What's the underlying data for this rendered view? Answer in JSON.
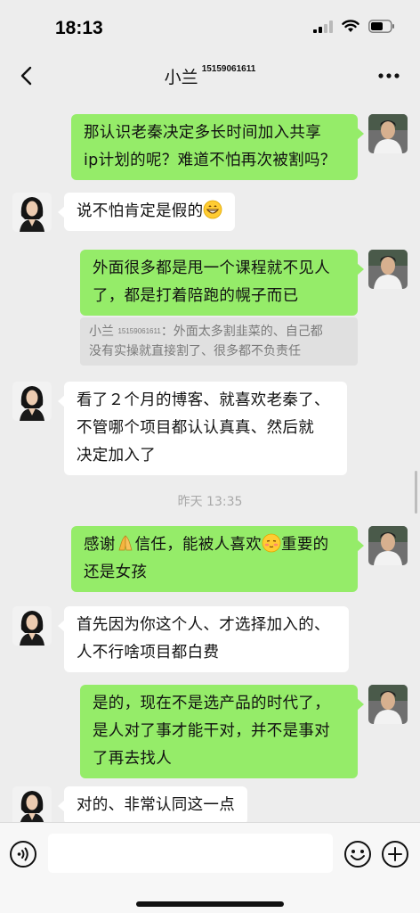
{
  "status_bar": {
    "time": "18:13"
  },
  "nav": {
    "title": "小兰",
    "phone": "15159061611"
  },
  "messages": [
    {
      "lines": [
        "那认识老秦决定多长时间加入共享",
        "ip计划的呢？难道不怕再次被割吗？"
      ]
    },
    {
      "text": "说不怕肯定是假的",
      "emoji": "grinning-emoji"
    },
    {
      "lines": [
        "外面很多都是甩一个课程就不见人",
        "了，都是打着陪跑的幌子而已"
      ]
    },
    {
      "quote_name": "小兰",
      "quote_phone": "15159061611",
      "quote_line1": "：外面太多割韭菜的、自己都",
      "quote_line2": "没有实操就直接割了、很多都不负责任"
    },
    {
      "lines": [
        "看了２个月的博客、就喜欢老秦了、",
        "不管哪个项目都认认真真、然后就",
        "决定加入了"
      ]
    },
    {
      "timestamp": "昨天 13:35"
    },
    {
      "line1_a": "感谢",
      "line1_b": "信任，能被人喜欢",
      "line1_c": "重要的",
      "line2": "还是女孩",
      "emoji1": "folded-hands-emoji",
      "emoji2": "blushing-emoji"
    },
    {
      "lines": [
        "首先因为你这个人、才选择加入的、",
        "人不行啥项目都白费"
      ]
    },
    {
      "lines": [
        "是的，现在不是选产品的时代了，",
        "是人对了事才能干对，并不是事对",
        "了再去找人"
      ]
    },
    {
      "text": "对的、非常认同这一点"
    }
  ],
  "colors": {
    "my_bubble": "#95ec69",
    "other_bubble": "#ffffff",
    "background": "#ededed"
  },
  "icons": [
    "back-icon",
    "more-icon",
    "voice-icon",
    "emoji-icon",
    "plus-icon",
    "signal-icon",
    "wifi-icon",
    "battery-icon"
  ]
}
